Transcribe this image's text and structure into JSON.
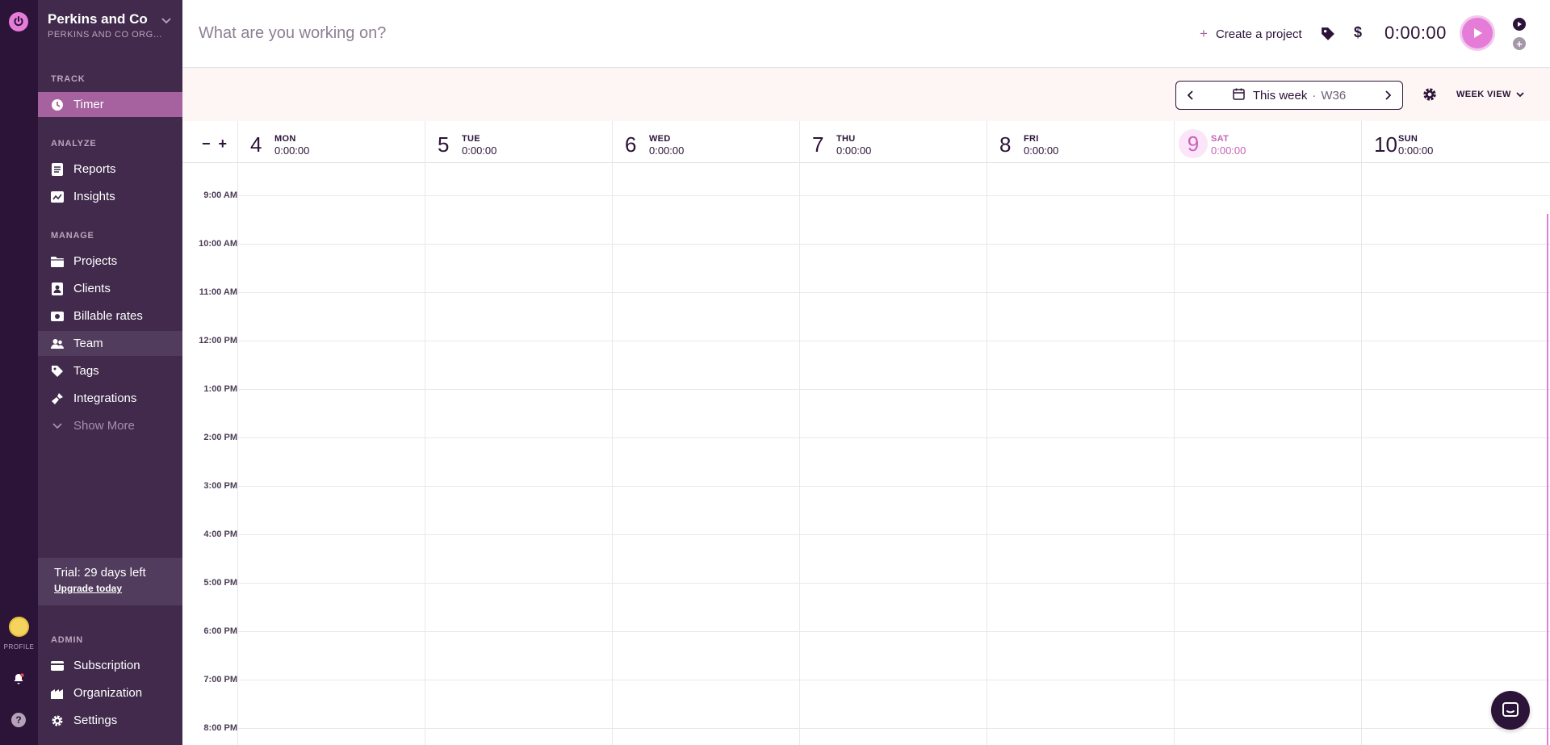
{
  "workspace": {
    "name": "Perkins and Co",
    "org": "PERKINS AND CO ORGANIZATION"
  },
  "rail": {
    "profile_label": "PROFILE",
    "help_label": "?"
  },
  "sidebar": {
    "track_label": "TRACK",
    "analyze_label": "ANALYZE",
    "manage_label": "MANAGE",
    "admin_label": "ADMIN",
    "items": {
      "timer": "Timer",
      "reports": "Reports",
      "insights": "Insights",
      "projects": "Projects",
      "clients": "Clients",
      "billable": "Billable rates",
      "team": "Team",
      "tags": "Tags",
      "integrations": "Integrations",
      "show_more": "Show More",
      "subscription": "Subscription",
      "organization": "Organization",
      "settings": "Settings"
    },
    "trial": {
      "text": "Trial: 29 days left",
      "link": "Upgrade today"
    }
  },
  "header": {
    "description_placeholder": "What are you working on?",
    "create_project": "Create a project",
    "dollar": "$",
    "timer": "0:00:00"
  },
  "toolbar": {
    "week_label": "This week",
    "separator": "·",
    "week_number": "W36",
    "view": "WEEK VIEW"
  },
  "calendar": {
    "zoom_out": "−",
    "zoom_in": "+",
    "days": [
      {
        "num": "4",
        "name": "MON",
        "duration": "0:00:00"
      },
      {
        "num": "5",
        "name": "TUE",
        "duration": "0:00:00"
      },
      {
        "num": "6",
        "name": "WED",
        "duration": "0:00:00"
      },
      {
        "num": "7",
        "name": "THU",
        "duration": "0:00:00"
      },
      {
        "num": "8",
        "name": "FRI",
        "duration": "0:00:00"
      },
      {
        "num": "9",
        "name": "SAT",
        "duration": "0:00:00"
      },
      {
        "num": "10",
        "name": "SUN",
        "duration": "0:00:00"
      }
    ],
    "hours": [
      "9:00 AM",
      "10:00 AM",
      "11:00 AM",
      "12:00 PM",
      "1:00 PM",
      "2:00 PM",
      "3:00 PM",
      "4:00 PM",
      "5:00 PM",
      "6:00 PM",
      "7:00 PM",
      "8:00 PM"
    ]
  },
  "colors": {
    "accent": "#e57cd8",
    "rail": "#2c1338",
    "sidebar": "#412a4c",
    "active": "#a6619f"
  }
}
